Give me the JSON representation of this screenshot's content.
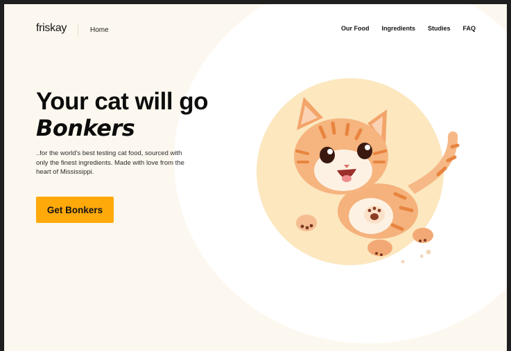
{
  "brand": {
    "name": "friskay"
  },
  "header": {
    "home_label": "Home",
    "nav": [
      "Our Food",
      "Ingredients",
      "Studies",
      "FAQ"
    ]
  },
  "hero": {
    "headline_line1": "Your cat will go",
    "headline_line2": "Bonkers",
    "subtext": "..for the world's best testing cat food, sourced with only the finest ingredients. Made with love from the heart of Mississippi.",
    "cta_label": "Get Bonkers"
  },
  "colors": {
    "accent": "#ffa90a",
    "page_background": "#fdf8ef",
    "circle_highlight": "#fce7bf"
  },
  "illustration": {
    "icon": "kitten-illustration"
  }
}
